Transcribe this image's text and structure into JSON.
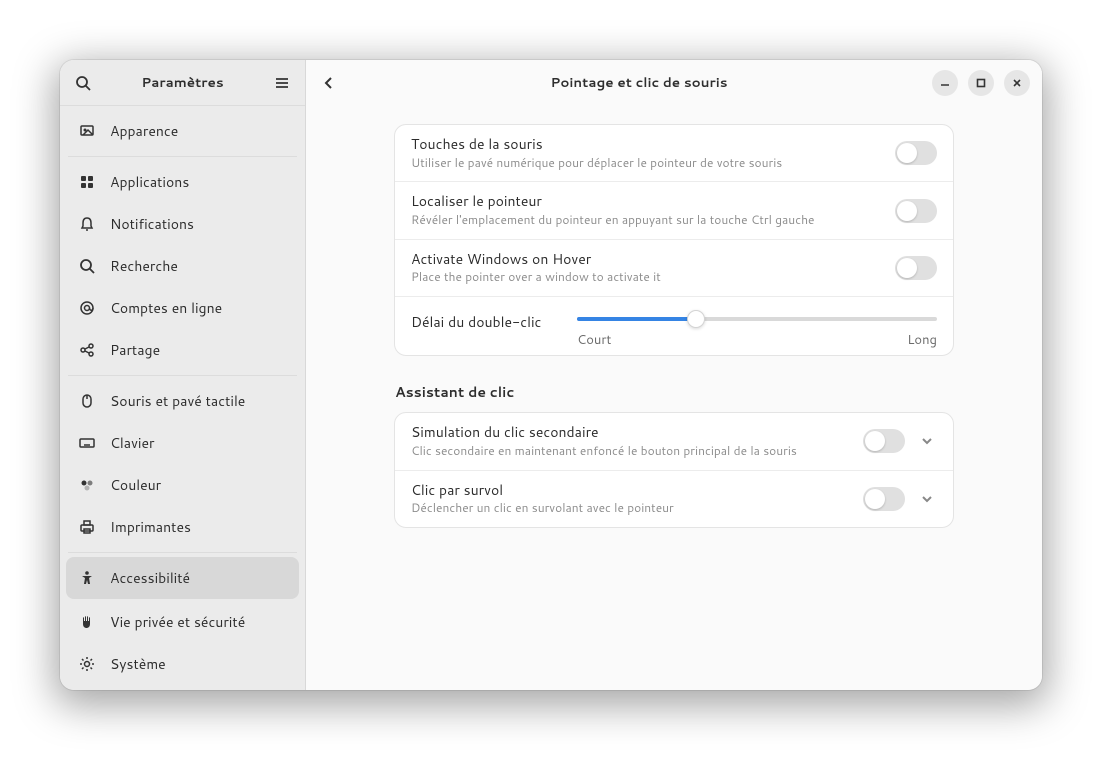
{
  "sidebar": {
    "title": "Paramètres",
    "items": [
      {
        "label": "Apparence"
      },
      {
        "label": "Applications"
      },
      {
        "label": "Notifications"
      },
      {
        "label": "Recherche"
      },
      {
        "label": "Comptes en ligne"
      },
      {
        "label": "Partage"
      },
      {
        "label": "Souris et pavé tactile"
      },
      {
        "label": "Clavier"
      },
      {
        "label": "Couleur"
      },
      {
        "label": "Imprimantes"
      },
      {
        "label": "Accessibilité"
      },
      {
        "label": "Vie privée et sécurité"
      },
      {
        "label": "Système"
      }
    ]
  },
  "header": {
    "title": "Pointage et clic de souris"
  },
  "main_group": {
    "rows": [
      {
        "title": "Touches de la souris",
        "subtitle": "Utiliser le pavé numérique pour déplacer le pointeur de votre souris",
        "switch": false
      },
      {
        "title": "Localiser le pointeur",
        "subtitle": "Révéler l'emplacement du pointeur en appuyant sur la touche Ctrl gauche",
        "switch": false
      },
      {
        "title": "Activate Windows on Hover",
        "subtitle": "Place the pointer over a window to activate it",
        "switch": false
      }
    ],
    "slider": {
      "label": "Délai du double-clic",
      "min_label": "Court",
      "max_label": "Long",
      "value_pct": 33
    }
  },
  "click_assist": {
    "heading": "Assistant de clic",
    "rows": [
      {
        "title": "Simulation du clic secondaire",
        "subtitle": "Clic secondaire en maintenant enfoncé le bouton principal de la souris",
        "switch": false
      },
      {
        "title": "Clic par survol",
        "subtitle": "Déclencher un clic en survolant avec le pointeur",
        "switch": false
      }
    ]
  }
}
